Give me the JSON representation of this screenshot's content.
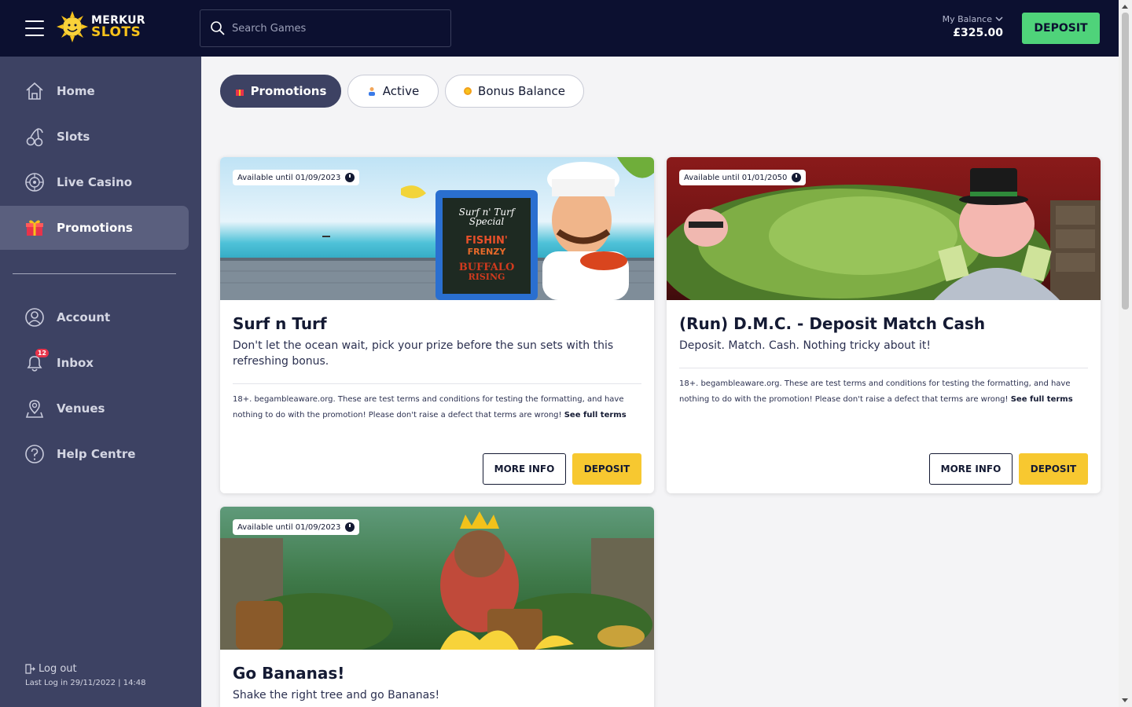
{
  "header": {
    "logo_line1": "MERKUR",
    "logo_line2": "SLOTS",
    "search_placeholder": "Search Games",
    "balance_label": "My Balance",
    "balance_amount": "£325.00",
    "deposit_label": "DEPOSIT"
  },
  "sidebar": {
    "items": [
      {
        "label": "Home",
        "icon": "home-icon"
      },
      {
        "label": "Slots",
        "icon": "cherries-icon"
      },
      {
        "label": "Live Casino",
        "icon": "roulette-icon"
      },
      {
        "label": "Promotions",
        "icon": "gift-icon",
        "active": true
      },
      {
        "label": "Account",
        "icon": "user-icon"
      },
      {
        "label": "Inbox",
        "icon": "bell-icon",
        "badge": "12"
      },
      {
        "label": "Venues",
        "icon": "location-icon"
      },
      {
        "label": "Help Centre",
        "icon": "help-icon"
      }
    ],
    "logout_label": "Log out",
    "last_login": "Last Log in 29/11/2022 | 14:48"
  },
  "tabs": [
    {
      "label": "Promotions",
      "active": true
    },
    {
      "label": "Active"
    },
    {
      "label": "Bonus Balance"
    }
  ],
  "promotions": [
    {
      "available": "Available until 01/09/2023",
      "title": "Surf n Turf",
      "description": "Don't let the ocean wait,  pick your prize before the sun sets with this refreshing bonus.",
      "terms": "18+. begambleaware.org. These are test terms and conditions for testing the formatting, and have nothing to do with the promotion! Please don't raise a defect that terms are wrong!",
      "terms_link": "See full terms",
      "more_info": "MORE INFO",
      "deposit": "DEPOSIT",
      "image_text": [
        "Surf n' Turf",
        "Special",
        "FISHIN'",
        "FRENZY",
        "BUFFALO",
        "RISING"
      ]
    },
    {
      "available": "Available until 01/01/2050",
      "title": "(Run) D.M.C. - Deposit Match Cash",
      "description": "Deposit. Match. Cash. Nothing tricky about it!",
      "terms": "18+. begambleaware.org. These are test terms and conditions for testing the formatting, and have nothing to do with the promotion! Please don't raise a defect that terms are wrong!",
      "terms_link": "See full terms",
      "more_info": "MORE INFO",
      "deposit": "DEPOSIT"
    },
    {
      "available": "Available until 01/09/2023",
      "title": "Go Bananas!",
      "description": "Shake the right tree and go Bananas!"
    }
  ],
  "colors": {
    "header_bg": "#0c1030",
    "sidebar_bg": "#3d4263",
    "deposit_green": "#4fd37a",
    "deposit_yellow": "#f7c830"
  }
}
